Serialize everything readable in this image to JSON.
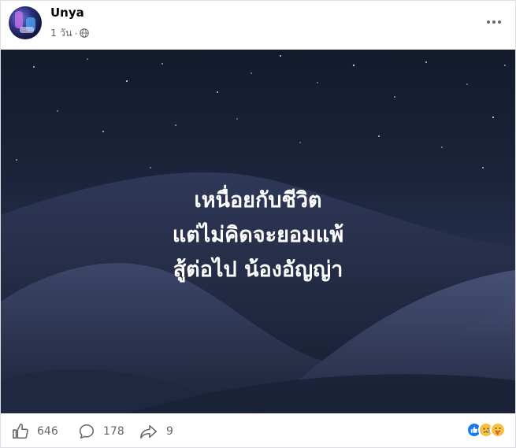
{
  "post": {
    "author": "Unya",
    "time": "1 วัน",
    "privacy_icon": "globe-icon",
    "caption_lines": [
      "เหนื่อยกับชีวิต",
      "แต่ไม่คิดจะยอมแพ้",
      "สู้ต่อไป น้องอัญญ่า"
    ]
  },
  "stats": {
    "likes": "646",
    "comments": "178",
    "shares": "9"
  },
  "reactions": [
    "like-icon",
    "sad-icon",
    "care-icon"
  ],
  "colors": {
    "like_blue": "#1877f2",
    "muted_text": "#65676b"
  }
}
